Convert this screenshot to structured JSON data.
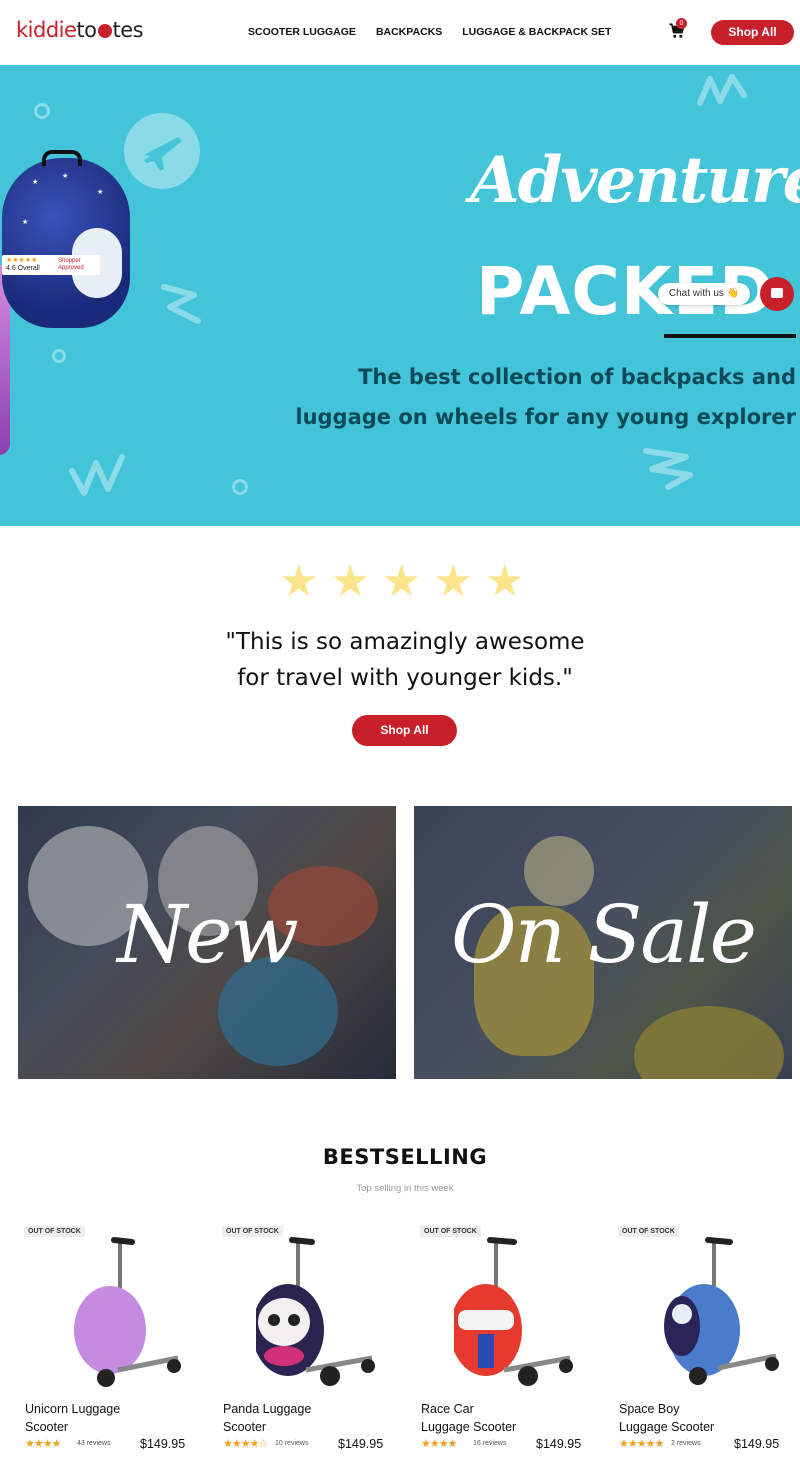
{
  "header": {
    "logo_left": "kiddie",
    "logo_right": "tes",
    "logo_mid": "to",
    "nav": [
      "SCOOTER LUGGAGE",
      "BACKPACKS",
      "LUGGAGE & BACKPACK SET"
    ],
    "cart_count": "0",
    "shop_all": "Shop All"
  },
  "hero": {
    "headline_script": "Adventure",
    "headline_bold": "PACKED",
    "tagline_line1": "The best collection of backpacks and",
    "tagline_line2": "luggage on wheels for any young explorer",
    "badge_rating": "4.6 Overall",
    "badge_stars": "★★★★★",
    "badge_brand_1": "Shopper",
    "badge_brand_2": "Approved",
    "chat_label": "Chat with us 👋",
    "bg_color": "#44c4d8"
  },
  "testimonial": {
    "stars": [
      "★",
      "★",
      "★",
      "★",
      "★"
    ],
    "quote_line1": "\"This is so amazingly awesome",
    "quote_line2": "for travel with younger kids.\"",
    "button": "Shop All"
  },
  "promos": [
    {
      "label": "New"
    },
    {
      "label": "On Sale"
    }
  ],
  "bestselling": {
    "title": "BESTSELLING",
    "subtitle": "Top selling in this week",
    "products": [
      {
        "badge": "OUT OF STOCK",
        "name_1": "Unicorn Luggage",
        "name_2": "Scooter",
        "stars": "★★★★",
        "reviews": "43 reviews",
        "price": "$149.95",
        "color": "#c58be0"
      },
      {
        "badge": "OUT OF STOCK",
        "name_1": "Panda Luggage",
        "name_2": "Scooter",
        "stars": "★★★★☆",
        "reviews": "10 reviews",
        "price": "$149.95",
        "color": "#2b2450"
      },
      {
        "badge": "OUT OF STOCK",
        "name_1": "Race Car",
        "name_2": "Luggage Scooter",
        "stars": "★★★★",
        "reviews": "16 reviews",
        "price": "$149.95",
        "color": "#e63a2e"
      },
      {
        "badge": "OUT OF STOCK",
        "name_1": "Space Boy",
        "name_2": "Luggage Scooter",
        "stars": "★★★★★",
        "reviews": "2 reviews",
        "price": "$149.95",
        "color": "#4a7ccc"
      }
    ]
  },
  "colors": {
    "accent": "#c8202a",
    "star": "#fbe48a"
  }
}
